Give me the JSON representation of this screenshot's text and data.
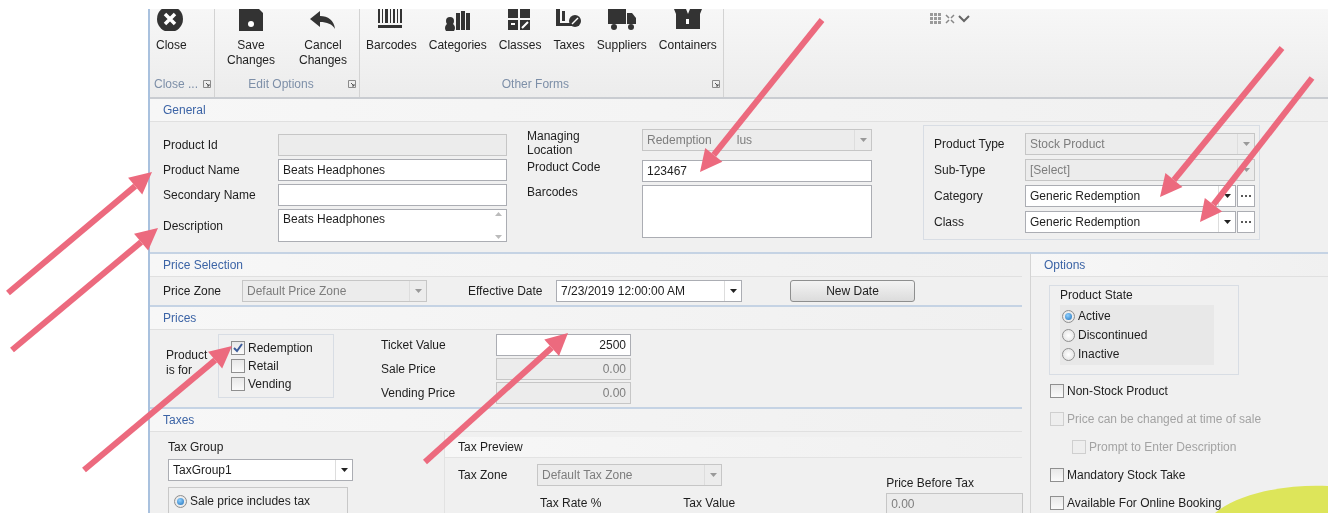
{
  "ribbon": {
    "groups": [
      {
        "label": "Close ...",
        "buttons": [
          {
            "label": "Close"
          }
        ]
      },
      {
        "label": "Edit Options",
        "buttons": [
          {
            "label": "Save Changes"
          },
          {
            "label": "Cancel Changes"
          }
        ]
      },
      {
        "label": "Other Forms",
        "buttons": [
          {
            "label": "Barcodes"
          },
          {
            "label": "Categories"
          },
          {
            "label": "Classes"
          },
          {
            "label": "Taxes"
          },
          {
            "label": "Suppliers"
          },
          {
            "label": "Containers"
          }
        ]
      }
    ]
  },
  "general": {
    "title": "General",
    "left_fields": [
      {
        "label": "Product Id",
        "kind": "text",
        "disabled": true
      },
      {
        "label": "Product Name",
        "kind": "text",
        "value": "Beats Headphones",
        "disabled": false
      },
      {
        "label": "Secondary Name",
        "kind": "text",
        "disabled": false
      },
      {
        "label": "Description",
        "kind": "memo",
        "value": "Beats Headphones",
        "disabled": false
      }
    ],
    "middle_fields": [
      {
        "label": "Managing Location",
        "kind": "combo",
        "value": "Redemption",
        "value_tail": "lus",
        "disabled": true
      },
      {
        "label": "Product Code",
        "kind": "text",
        "value": "123467",
        "disabled": false
      },
      {
        "label": "Barcodes",
        "kind": "list",
        "disabled": false
      }
    ],
    "right_fields": [
      {
        "label": "Product Type",
        "kind": "combo",
        "value": "Stock Product",
        "disabled": true
      },
      {
        "label": "Sub-Type",
        "kind": "combo",
        "value": "[Select]",
        "disabled": true
      },
      {
        "label": "Category",
        "kind": "lookup",
        "value": "Generic Redemption",
        "disabled": false
      },
      {
        "label": "Class",
        "kind": "lookup",
        "value": "Generic Redemption",
        "disabled": false
      }
    ]
  },
  "price_selection": {
    "title": "Price Selection",
    "price_zone": {
      "label": "Price Zone",
      "value": "Default Price Zone",
      "disabled": true
    },
    "effective_date": {
      "label": "Effective Date",
      "value": "7/23/2019 12:00:00 AM"
    },
    "new_date_button": "New Date"
  },
  "prices": {
    "title": "Prices",
    "product_for_label": "Product is for",
    "types": [
      {
        "label": "Redemption",
        "checked": true
      },
      {
        "label": "Retail",
        "checked": false
      },
      {
        "label": "Vending",
        "checked": false
      }
    ],
    "values": [
      {
        "label": "Ticket Value",
        "value": "2500",
        "disabled": false
      },
      {
        "label": "Sale Price",
        "value": "0.00",
        "disabled": true
      },
      {
        "label": "Vending Price",
        "value": "0.00",
        "disabled": true
      }
    ]
  },
  "taxes": {
    "title": "Taxes",
    "tax_group": {
      "label": "Tax Group",
      "value": "TaxGroup1"
    },
    "tax_inclusion": [
      {
        "label": "Sale price includes tax",
        "selected": true
      }
    ],
    "preview": {
      "title": "Tax Preview",
      "tax_zone": {
        "label": "Tax Zone",
        "value": "Default Tax Zone",
        "disabled": true
      },
      "columns": [
        "Tax Rate %",
        "Tax Value"
      ],
      "price_before_tax": {
        "label": "Price Before Tax",
        "value": "0.00",
        "disabled": true
      }
    }
  },
  "options": {
    "title": "Options",
    "product_state": {
      "title": "Product State",
      "choices": [
        {
          "label": "Active",
          "selected": true
        },
        {
          "label": "Discontinued",
          "selected": false
        },
        {
          "label": "Inactive",
          "selected": false
        }
      ]
    },
    "flags": [
      {
        "label": "Non-Stock Product",
        "checked": false,
        "disabled": false
      },
      {
        "label": "Price can be changed at time of sale",
        "checked": false,
        "disabled": true,
        "children": [
          {
            "label": "Prompt to Enter Description",
            "checked": false,
            "disabled": true
          }
        ]
      },
      {
        "label": "Mandatory Stock Take",
        "checked": false,
        "disabled": false
      },
      {
        "label": "Available For Online Booking",
        "checked": false,
        "disabled": false
      }
    ]
  }
}
